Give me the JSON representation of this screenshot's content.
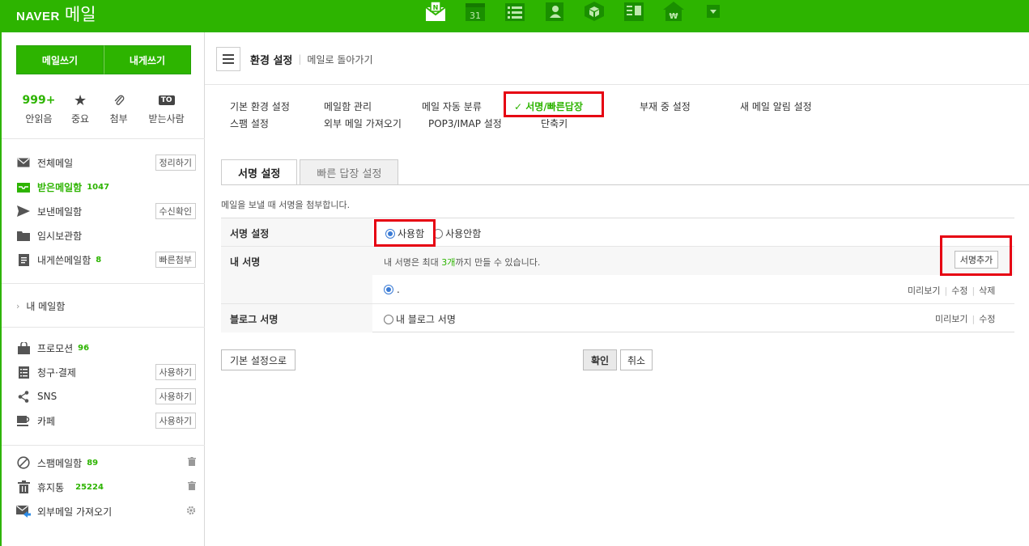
{
  "brand": {
    "naver": "NAVER",
    "mail": "메일"
  },
  "top_icons": [
    "mail-app-icon",
    "calendar-icon",
    "list-icon",
    "contacts-icon",
    "box-icon",
    "memo-icon",
    "pay-icon",
    "more-dropdown-icon"
  ],
  "calendar_day": "31",
  "sidebar": {
    "write_btn": "메일쓰기",
    "self_btn": "내게쓰기",
    "quick": [
      {
        "top": "999+",
        "label": "안읽음"
      },
      {
        "top": "★",
        "label": "중요"
      },
      {
        "top": "📎",
        "label": "첨부"
      },
      {
        "top": "TO",
        "label": "받는사람"
      }
    ],
    "boxes": [
      {
        "name": "전체메일",
        "tag": "정리하기"
      },
      {
        "name": "받은메일함",
        "count": "1047"
      },
      {
        "name": "보낸메일함",
        "tag": "수신확인"
      },
      {
        "name": "임시보관함"
      },
      {
        "name": "내게쓴메일함",
        "count": "8",
        "tag": "빠른첨부"
      }
    ],
    "my_mail": "내 메일함",
    "extras": [
      {
        "name": "프로모션",
        "count": "96"
      },
      {
        "name": "청구·결제",
        "tag": "사용하기"
      },
      {
        "name": "SNS",
        "tag": "사용하기"
      },
      {
        "name": "카페",
        "tag": "사용하기"
      }
    ],
    "bottom": [
      {
        "name": "스팸메일함",
        "count": "89"
      },
      {
        "name": "휴지통",
        "count": "25224"
      },
      {
        "name": "외부메일 가져오기"
      }
    ]
  },
  "header": {
    "title": "환경 설정",
    "back": "메일로 돌아가기"
  },
  "settings_tabs": {
    "basic": "기본 환경 설정",
    "mailbox": "메일함 관리",
    "auto": "메일 자동 분류",
    "sign": "서명/빠른답장",
    "absence": "부재 중 설정",
    "alarm": "새 메일 알림 설정",
    "spam": "스팸 설정",
    "external": "외부 메일 가져오기",
    "pop": "POP3/IMAP 설정",
    "shortcut": "단축키",
    "check": "✓"
  },
  "sub_tabs": {
    "sign": "서명 설정",
    "reply": "빠른 답장 설정"
  },
  "desc": "메일을 보낼 때 서명을 첨부합니다.",
  "table": {
    "sign_setting": "서명 설정",
    "use": "사용함",
    "nouse": "사용안함",
    "my_sign": "내 서명",
    "limit_pre": "내 서명은 최대 ",
    "limit_num": "3개",
    "limit_post": "까지 만들 수 있습니다.",
    "add_btn": "서명추가",
    "sign_item": ".",
    "preview": "미리보기",
    "edit": "수정",
    "delete": "삭제",
    "blog_sign": "블로그 서명",
    "blog_item": "내 블로그 서명"
  },
  "buttons": {
    "reset": "기본 설정으로",
    "ok": "확인",
    "cancel": "취소"
  }
}
